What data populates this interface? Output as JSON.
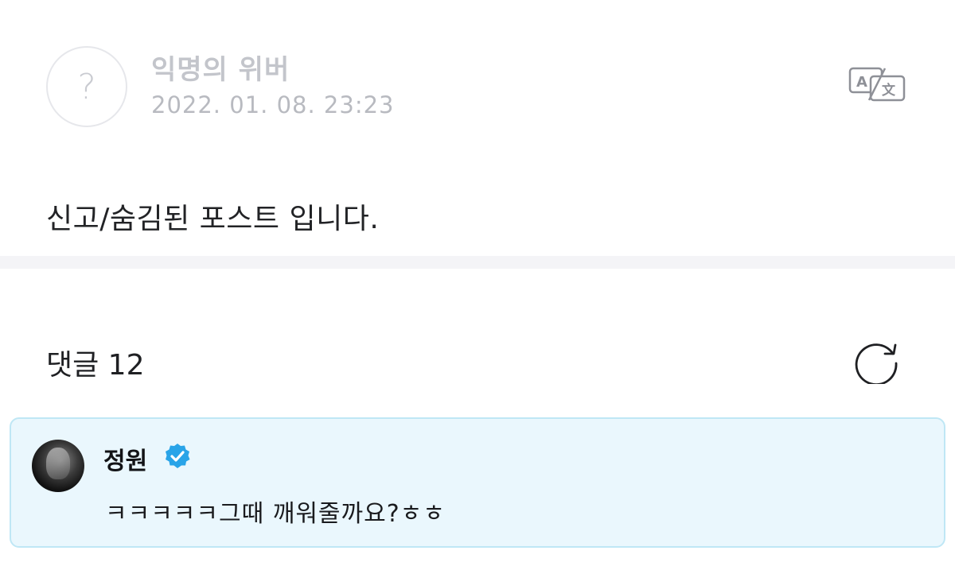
{
  "post": {
    "author": "익명의 위버",
    "avatar_glyph": "?",
    "date": "2022. 01. 08. 23:23",
    "body": "신고/숨김된 포스트 입니다.",
    "translate_icon": "translate-icon"
  },
  "comments": {
    "title": "댓글 12",
    "refresh_icon": "refresh-icon",
    "items": [
      {
        "author": "정원",
        "verified": true,
        "text": "ㅋㅋㅋㅋㅋ그때 깨워줄까요?ㅎㅎ"
      }
    ]
  },
  "colors": {
    "verified_badge": "#29a4e8",
    "comment_bg": "#eaf7fd",
    "comment_border": "#bfe7f5"
  }
}
